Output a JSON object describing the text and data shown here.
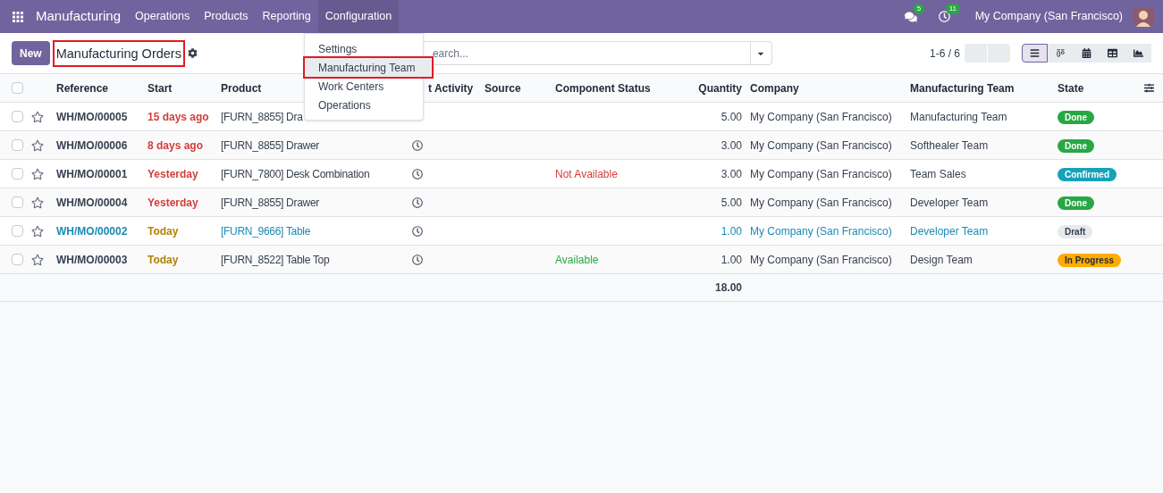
{
  "navbar": {
    "app": "Manufacturing",
    "menus": [
      {
        "label": "Operations",
        "selected": false
      },
      {
        "label": "Products",
        "selected": false
      },
      {
        "label": "Reporting",
        "selected": false
      },
      {
        "label": "Configuration",
        "selected": true
      }
    ],
    "messages_count": "5",
    "activities_count": "11",
    "company": "My Company (San Francisco)"
  },
  "config_menu": [
    {
      "label": "Settings",
      "selected": false
    },
    {
      "label": "Manufacturing Team",
      "selected": true
    },
    {
      "label": "Work Centers",
      "selected": false
    },
    {
      "label": "Operations",
      "selected": false
    }
  ],
  "control_panel": {
    "new_button": "New",
    "title": "Manufacturing Orders",
    "search_placeholder": "earch...",
    "pager": "1-6 / 6",
    "views": [
      {
        "kind": "list",
        "selected": true
      },
      {
        "kind": "kanban",
        "selected": false
      },
      {
        "kind": "calendar",
        "selected": false
      },
      {
        "kind": "pivot",
        "selected": false
      },
      {
        "kind": "graph",
        "selected": false
      }
    ]
  },
  "table": {
    "select_all_checked": false,
    "columns": [
      "Reference",
      "Start",
      "Product",
      "t Activity",
      "Source",
      "Component Status",
      "Quantity",
      "Company",
      "Manufacturing Team",
      "State"
    ],
    "rows": [
      {
        "kind": "normal",
        "checked": false,
        "reference": "WH/MO/00005",
        "start": "15 days ago",
        "start_overdue": true,
        "product": "[FURN_8855] Dra",
        "activity": false,
        "quantity": "5.00",
        "company": "My Company (San Francisco)",
        "team": "Manufacturing Team",
        "state": "Done",
        "color": "#28a745"
      },
      {
        "kind": "normal",
        "checked": false,
        "reference": "WH/MO/00006",
        "start": "8 days ago",
        "start_overdue": true,
        "product": "[FURN_8855] Drawer",
        "activity": true,
        "quantity": "3.00",
        "company": "My Company (San Francisco)",
        "team": "Softhealer Team",
        "state": "Done",
        "color": "#28a745"
      },
      {
        "kind": "normal",
        "checked": false,
        "reference": "WH/MO/00001",
        "start": "Yesterday",
        "start_overdue": true,
        "product": "[FURN_7800] Desk Combination",
        "activity": true,
        "component_status": "Not Available",
        "component_available": false,
        "quantity": "3.00",
        "company": "My Company (San Francisco)",
        "team": "Team Sales",
        "state": "Confirmed",
        "color": "#17a2b8"
      },
      {
        "kind": "normal",
        "checked": false,
        "reference": "WH/MO/00004",
        "start": "Yesterday",
        "start_overdue": true,
        "product": "[FURN_8855] Drawer",
        "activity": true,
        "quantity": "5.00",
        "company": "My Company (San Francisco)",
        "team": "Developer Team",
        "state": "Done",
        "color": "#28a745"
      },
      {
        "kind": "draft",
        "checked": false,
        "reference": "WH/MO/00002",
        "start": "Today",
        "start_overdue": false,
        "product": "[FURN_9666] Table",
        "activity": true,
        "quantity": "1.00",
        "company": "My Company (San Francisco)",
        "team": "Developer Team",
        "state": "Draft",
        "color": "#e7e9ed"
      },
      {
        "kind": "normal",
        "checked": false,
        "reference": "WH/MO/00003",
        "start": "Today",
        "start_overdue": false,
        "product": "[FURN_8522] Table Top",
        "activity": true,
        "component_status": "Available",
        "component_available": true,
        "quantity": "1.00",
        "company": "My Company (San Francisco)",
        "team": "Design Team",
        "state": "In Progress",
        "color": "#ffac00"
      }
    ],
    "total_quantity": "18.00"
  }
}
